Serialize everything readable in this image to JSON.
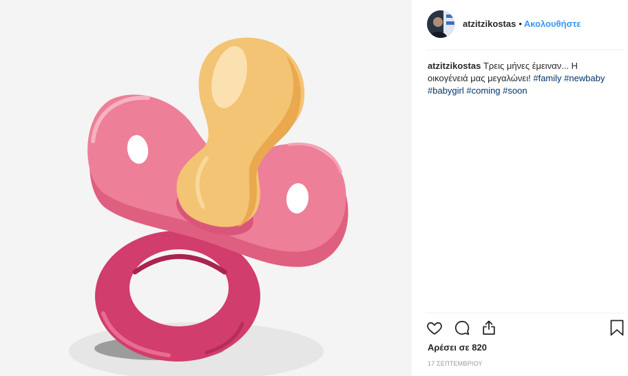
{
  "post": {
    "header": {
      "username": "atzitzikostas",
      "separator": "•",
      "follow_label": "Ακολουθήστε"
    },
    "caption": {
      "username": "atzitzikostas",
      "text": "Τρεις μήνες έμειναν... Η οικογένειά μας μεγαλώνει!",
      "hashtags": [
        "#family",
        "#newbaby",
        "#babygirl",
        "#coming",
        "#soon"
      ]
    },
    "actions": {
      "like_icon": "heart-icon",
      "comment_icon": "comment-icon",
      "share_icon": "share-icon",
      "save_icon": "bookmark-icon"
    },
    "likes_label": "Αρέσει σε 820",
    "date": "17 ΣΕΠΤΕΜΒΡΙΟΥ"
  },
  "colors": {
    "accent": "#3897f0",
    "hashtag": "#003569",
    "text": "#262626",
    "muted": "#999999",
    "divider": "#efefef"
  }
}
